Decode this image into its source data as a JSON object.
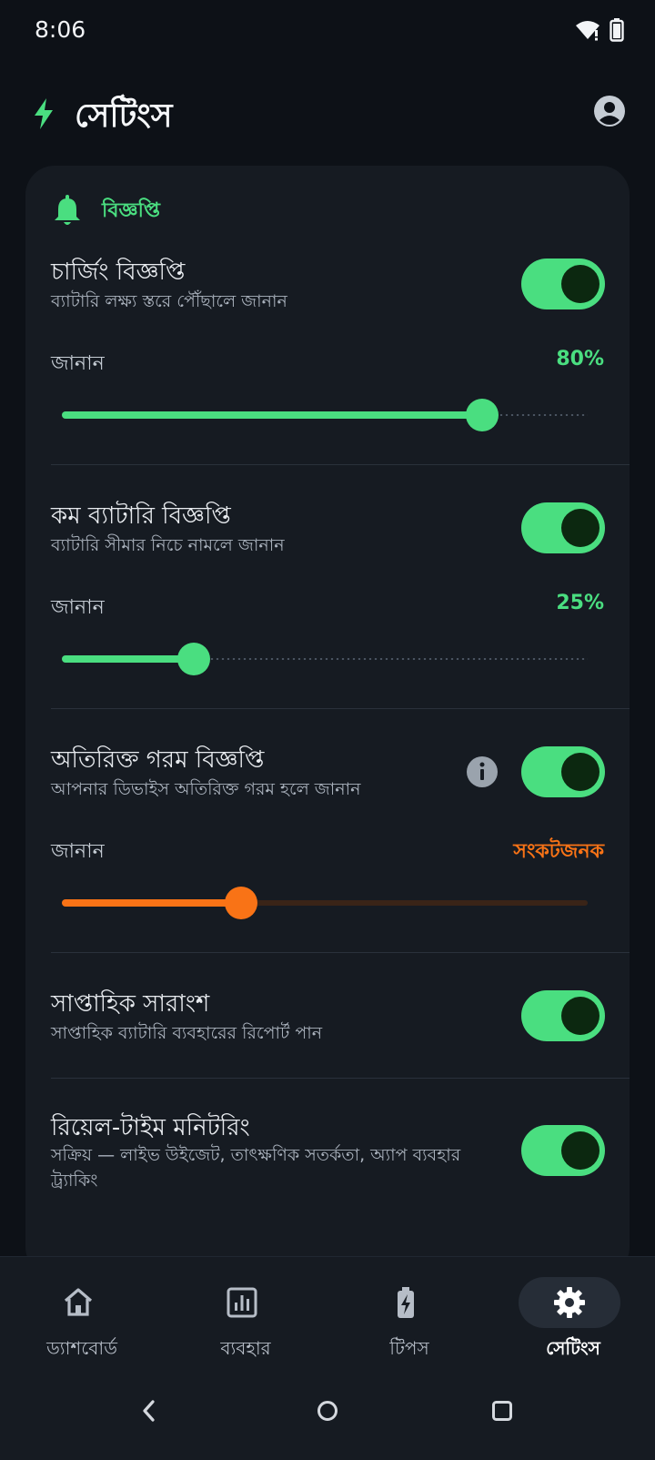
{
  "status_bar": {
    "time": "8:06"
  },
  "header": {
    "title": "সেটিংস"
  },
  "section": {
    "title": "বিজ্ঞপ্তি"
  },
  "rows": [
    {
      "title": "চার্জিং বিজ্ঞপ্তি",
      "subtitle": "ব্যাটারি লক্ষ্য স্তরে পৌঁছালে জানান",
      "enabled": true,
      "slider_label": "জানান",
      "slider_value": "80%",
      "slider_fraction": 0.8
    },
    {
      "title": "কম ব্যাটারি বিজ্ঞপ্তি",
      "subtitle": "ব্যাটারি সীমার নিচে নামলে জানান",
      "enabled": true,
      "slider_label": "জানান",
      "slider_value": "25%",
      "slider_fraction": 0.25
    },
    {
      "title": "অতিরিক্ত গরম বিজ্ঞপ্তি",
      "subtitle": "আপনার ডিভাইস অতিরিক্ত গরম হলে জানান",
      "enabled": true,
      "slider_label": "জানান",
      "slider_value": "সংকটজনক",
      "slider_fraction": 0.34
    },
    {
      "title": "সাপ্তাহিক সারাংশ",
      "subtitle": "সাপ্তাহিক ব্যাটারি ব্যবহারের রিপোর্ট পান",
      "enabled": true
    },
    {
      "title": "রিয়েল-টাইম মনিটরিং",
      "subtitle_line1": "সক্রিয় — লাইভ উইজেট, তাৎক্ষণিক সতর্কতা, অ্যাপ ব্যবহার",
      "subtitle_line2": "ট্র্যাকিং",
      "enabled": true
    }
  ],
  "nav": [
    {
      "label": "ড্যাশবোর্ড",
      "icon": "home-icon"
    },
    {
      "label": "ব্যবহার",
      "icon": "bar-chart-icon"
    },
    {
      "label": "টিপস",
      "icon": "battery-bolt-icon"
    },
    {
      "label": "সেটিংস",
      "icon": "gear-icon",
      "active": true
    }
  ],
  "colors": {
    "accent": "#4ade80",
    "warning": "#f97316",
    "background": "#0d1117",
    "card": "#161b22"
  }
}
